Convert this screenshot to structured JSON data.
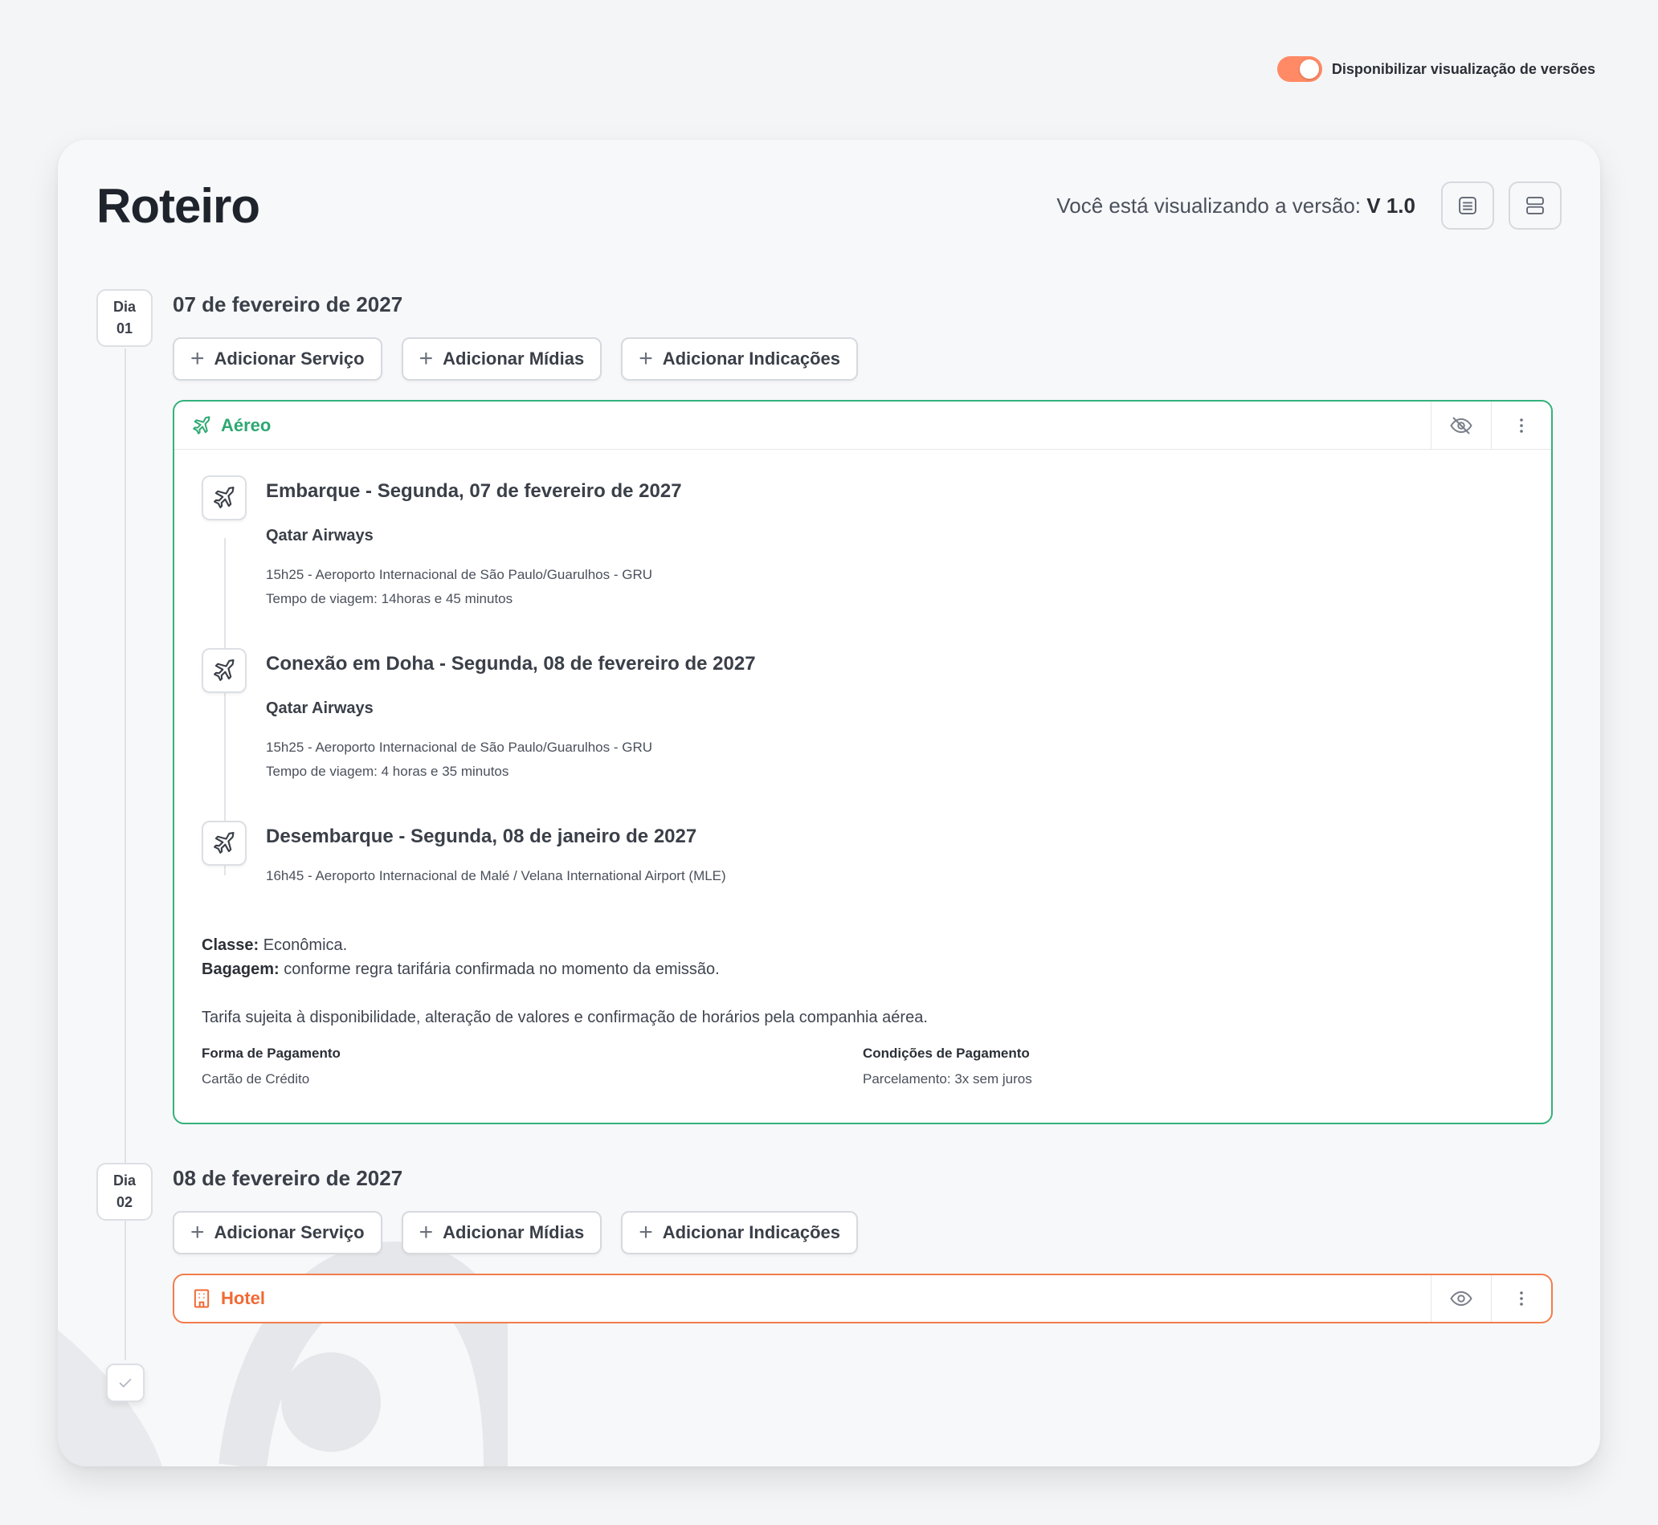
{
  "toggle": {
    "label": "Disponibilizar visualização de versões",
    "on": true,
    "color": "#ff8a65"
  },
  "page": {
    "title": "Roteiro",
    "version_prefix": "Você está visualizando a versão:",
    "version_value": "V 1.0",
    "view_buttons": [
      "list-view-icon",
      "stacked-view-icon"
    ]
  },
  "actions": {
    "add_service": "Adicionar Serviço",
    "add_media": "Adicionar Mídias",
    "add_indications": "Adicionar Indicações"
  },
  "days": [
    {
      "label": "Dia",
      "number": "01",
      "date": "07 de fevereiro de 2027",
      "service": {
        "type": "Aéreo",
        "color": "#34b27b",
        "segments": [
          {
            "title": "Embarque - Segunda, 07 de fevereiro de 2027",
            "airline": "Qatar Airways",
            "line1": "15h25 - Aeroporto Internacional de São Paulo/Guarulhos - GRU",
            "line2": "Tempo de viagem: 14horas e 45 minutos"
          },
          {
            "title": "Conexão em Doha - Segunda, 08 de fevereiro de 2027",
            "airline": "Qatar Airways",
            "line1": "15h25 - Aeroporto Internacional de São Paulo/Guarulhos - GRU",
            "line2": "Tempo de viagem: 4 horas e 35 minutos"
          },
          {
            "title": "Desembarque - Segunda,  08 de janeiro de 2027",
            "line1": "16h45 - Aeroporto Internacional de Malé / Velana International Airport (MLE)"
          }
        ],
        "class_label": "Classe:",
        "class_value": "Econômica.",
        "baggage_label": "Bagagem:",
        "baggage_value": "conforme regra tarifária confirmada no momento da emissão.",
        "fare_note": "Tarifa sujeita à disponibilidade, alteração de valores e confirmação de horários pela companhia aérea.",
        "payment_method_label": "Forma de Pagamento",
        "payment_method_value": "Cartão de Crédito",
        "payment_terms_label": "Condições de Pagamento",
        "payment_terms_value": "Parcelamento: 3x sem juros"
      }
    },
    {
      "label": "Dia",
      "number": "02",
      "date": "08 de fevereiro de 2027",
      "service": {
        "type": "Hotel",
        "color": "#f27c4d"
      }
    }
  ]
}
